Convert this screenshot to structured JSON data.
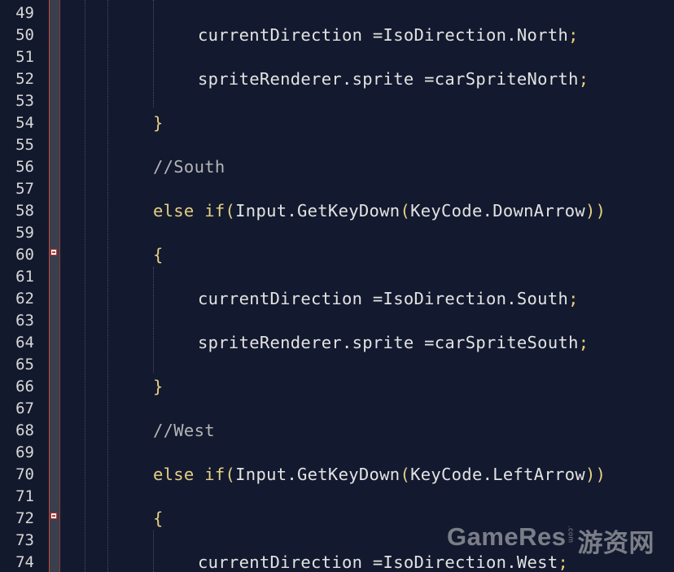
{
  "editor": {
    "lines": [
      {
        "num": "49",
        "indent": 0,
        "segments": []
      },
      {
        "num": "50",
        "indent": 3,
        "segments": [
          {
            "t": "currentDirection =IsoDirection.North",
            "c": ""
          },
          {
            "t": ";",
            "c": "pn"
          }
        ]
      },
      {
        "num": "51",
        "indent": 0,
        "segments": []
      },
      {
        "num": "52",
        "indent": 3,
        "segments": [
          {
            "t": "spriteRenderer.sprite =carSpriteNorth",
            "c": ""
          },
          {
            "t": ";",
            "c": "pn"
          }
        ]
      },
      {
        "num": "53",
        "indent": 0,
        "segments": []
      },
      {
        "num": "54",
        "indent": 2,
        "segments": [
          {
            "t": "}",
            "c": "br"
          }
        ]
      },
      {
        "num": "55",
        "indent": 0,
        "segments": []
      },
      {
        "num": "56",
        "indent": 2,
        "segments": [
          {
            "t": "//South",
            "c": "cm"
          }
        ]
      },
      {
        "num": "57",
        "indent": 0,
        "segments": []
      },
      {
        "num": "58",
        "indent": 2,
        "segments": [
          {
            "t": "else if",
            "c": "kw"
          },
          {
            "t": "(",
            "c": "br"
          },
          {
            "t": "Input.GetKeyDown",
            "c": ""
          },
          {
            "t": "(",
            "c": "br"
          },
          {
            "t": "KeyCode.DownArrow",
            "c": ""
          },
          {
            "t": "))",
            "c": "br"
          }
        ]
      },
      {
        "num": "59",
        "indent": 0,
        "segments": []
      },
      {
        "num": "60",
        "indent": 2,
        "fold": true,
        "segments": [
          {
            "t": "{",
            "c": "br"
          }
        ]
      },
      {
        "num": "61",
        "indent": 0,
        "segments": []
      },
      {
        "num": "62",
        "indent": 3,
        "segments": [
          {
            "t": "currentDirection =IsoDirection.South",
            "c": ""
          },
          {
            "t": ";",
            "c": "pn"
          }
        ]
      },
      {
        "num": "63",
        "indent": 0,
        "segments": []
      },
      {
        "num": "64",
        "indent": 3,
        "segments": [
          {
            "t": "spriteRenderer.sprite =carSpriteSouth",
            "c": ""
          },
          {
            "t": ";",
            "c": "pn"
          }
        ]
      },
      {
        "num": "65",
        "indent": 0,
        "segments": []
      },
      {
        "num": "66",
        "indent": 2,
        "segments": [
          {
            "t": "}",
            "c": "br"
          }
        ]
      },
      {
        "num": "67",
        "indent": 0,
        "segments": []
      },
      {
        "num": "68",
        "indent": 2,
        "segments": [
          {
            "t": "//West",
            "c": "cm"
          }
        ]
      },
      {
        "num": "69",
        "indent": 0,
        "segments": []
      },
      {
        "num": "70",
        "indent": 2,
        "segments": [
          {
            "t": "else if",
            "c": "kw"
          },
          {
            "t": "(",
            "c": "br"
          },
          {
            "t": "Input.GetKeyDown",
            "c": ""
          },
          {
            "t": "(",
            "c": "br"
          },
          {
            "t": "KeyCode.LeftArrow",
            "c": ""
          },
          {
            "t": "))",
            "c": "br"
          }
        ]
      },
      {
        "num": "71",
        "indent": 0,
        "segments": []
      },
      {
        "num": "72",
        "indent": 2,
        "fold": true,
        "segments": [
          {
            "t": "{",
            "c": "br"
          }
        ]
      },
      {
        "num": "73",
        "indent": 0,
        "segments": []
      },
      {
        "num": "74",
        "indent": 3,
        "segments": [
          {
            "t": "currentDirection =IsoDirection.West",
            "c": ""
          },
          {
            "t": ";",
            "c": "pn"
          }
        ]
      }
    ]
  },
  "watermark": {
    "brand": "GameRes",
    "domain": ".com",
    "cn": "游资网"
  },
  "colors": {
    "background": "#131a2f",
    "keyword": "#e7cf84",
    "comment": "#b5b5b5",
    "text": "#e3e3e3",
    "fold_margin": "#3a3f4d"
  }
}
